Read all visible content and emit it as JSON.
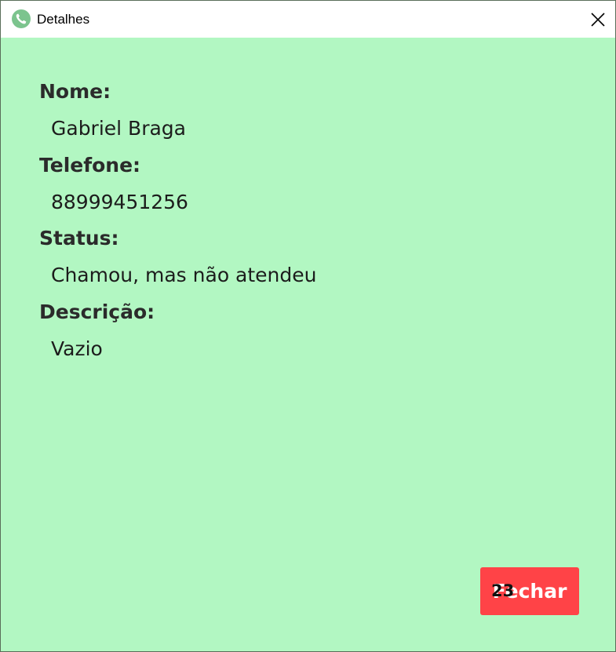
{
  "window": {
    "title": "Detalhes",
    "icon": "phone-icon",
    "close_icon": "close-icon",
    "background_color": "#b2f7c2"
  },
  "details": {
    "name_label": "Nome:",
    "name_value": "Gabriel Braga",
    "phone_label": "Telefone:",
    "phone_value": "88999451256",
    "status_label": "Status:",
    "status_value": "Chamou, mas não atendeu",
    "description_label": "Descrição:",
    "description_value": "Vazio"
  },
  "actions": {
    "close_label": "Fechar",
    "close_color": "#ff4347",
    "counter": "23"
  }
}
